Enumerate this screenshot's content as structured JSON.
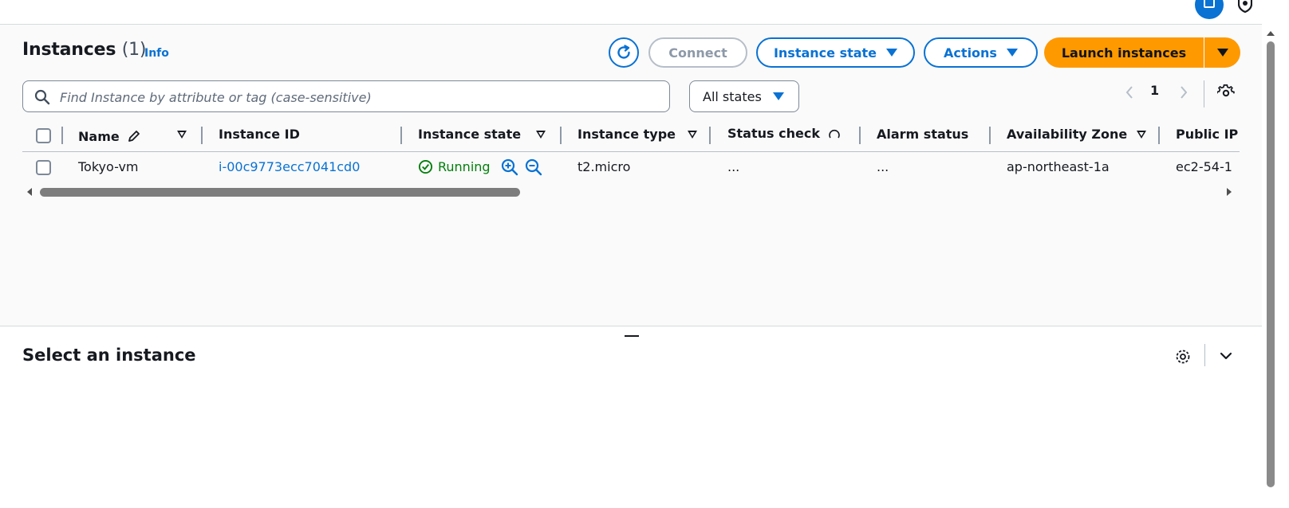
{
  "header": {
    "title": "Instances",
    "count": "(1)",
    "info_label": "Info"
  },
  "toolbar": {
    "connect_label": "Connect",
    "instance_state_label": "Instance state",
    "actions_label": "Actions",
    "launch_label": "Launch instances"
  },
  "filter": {
    "search_placeholder": "Find Instance by attribute or tag (case-sensitive)",
    "search_value": "",
    "states_selected": "All states"
  },
  "pagination": {
    "current_page": "1"
  },
  "table": {
    "columns": [
      "Name",
      "Instance ID",
      "Instance state",
      "Instance type",
      "Status check",
      "Alarm status",
      "Availability Zone",
      "Public IP"
    ],
    "rows": [
      {
        "name": "Tokyo-vm",
        "instance_id": "i-00c9773ecc7041cd0",
        "state": "Running",
        "type": "t2.micro",
        "status_check": "...",
        "alarm_status": "...",
        "availability_zone": "ap-northeast-1a",
        "public_ip": "ec2-54-1"
      }
    ]
  },
  "details": {
    "title": "Select an instance"
  },
  "colors": {
    "accent": "#0972d3",
    "launch": "#ff9900",
    "running": "#037f0c"
  }
}
